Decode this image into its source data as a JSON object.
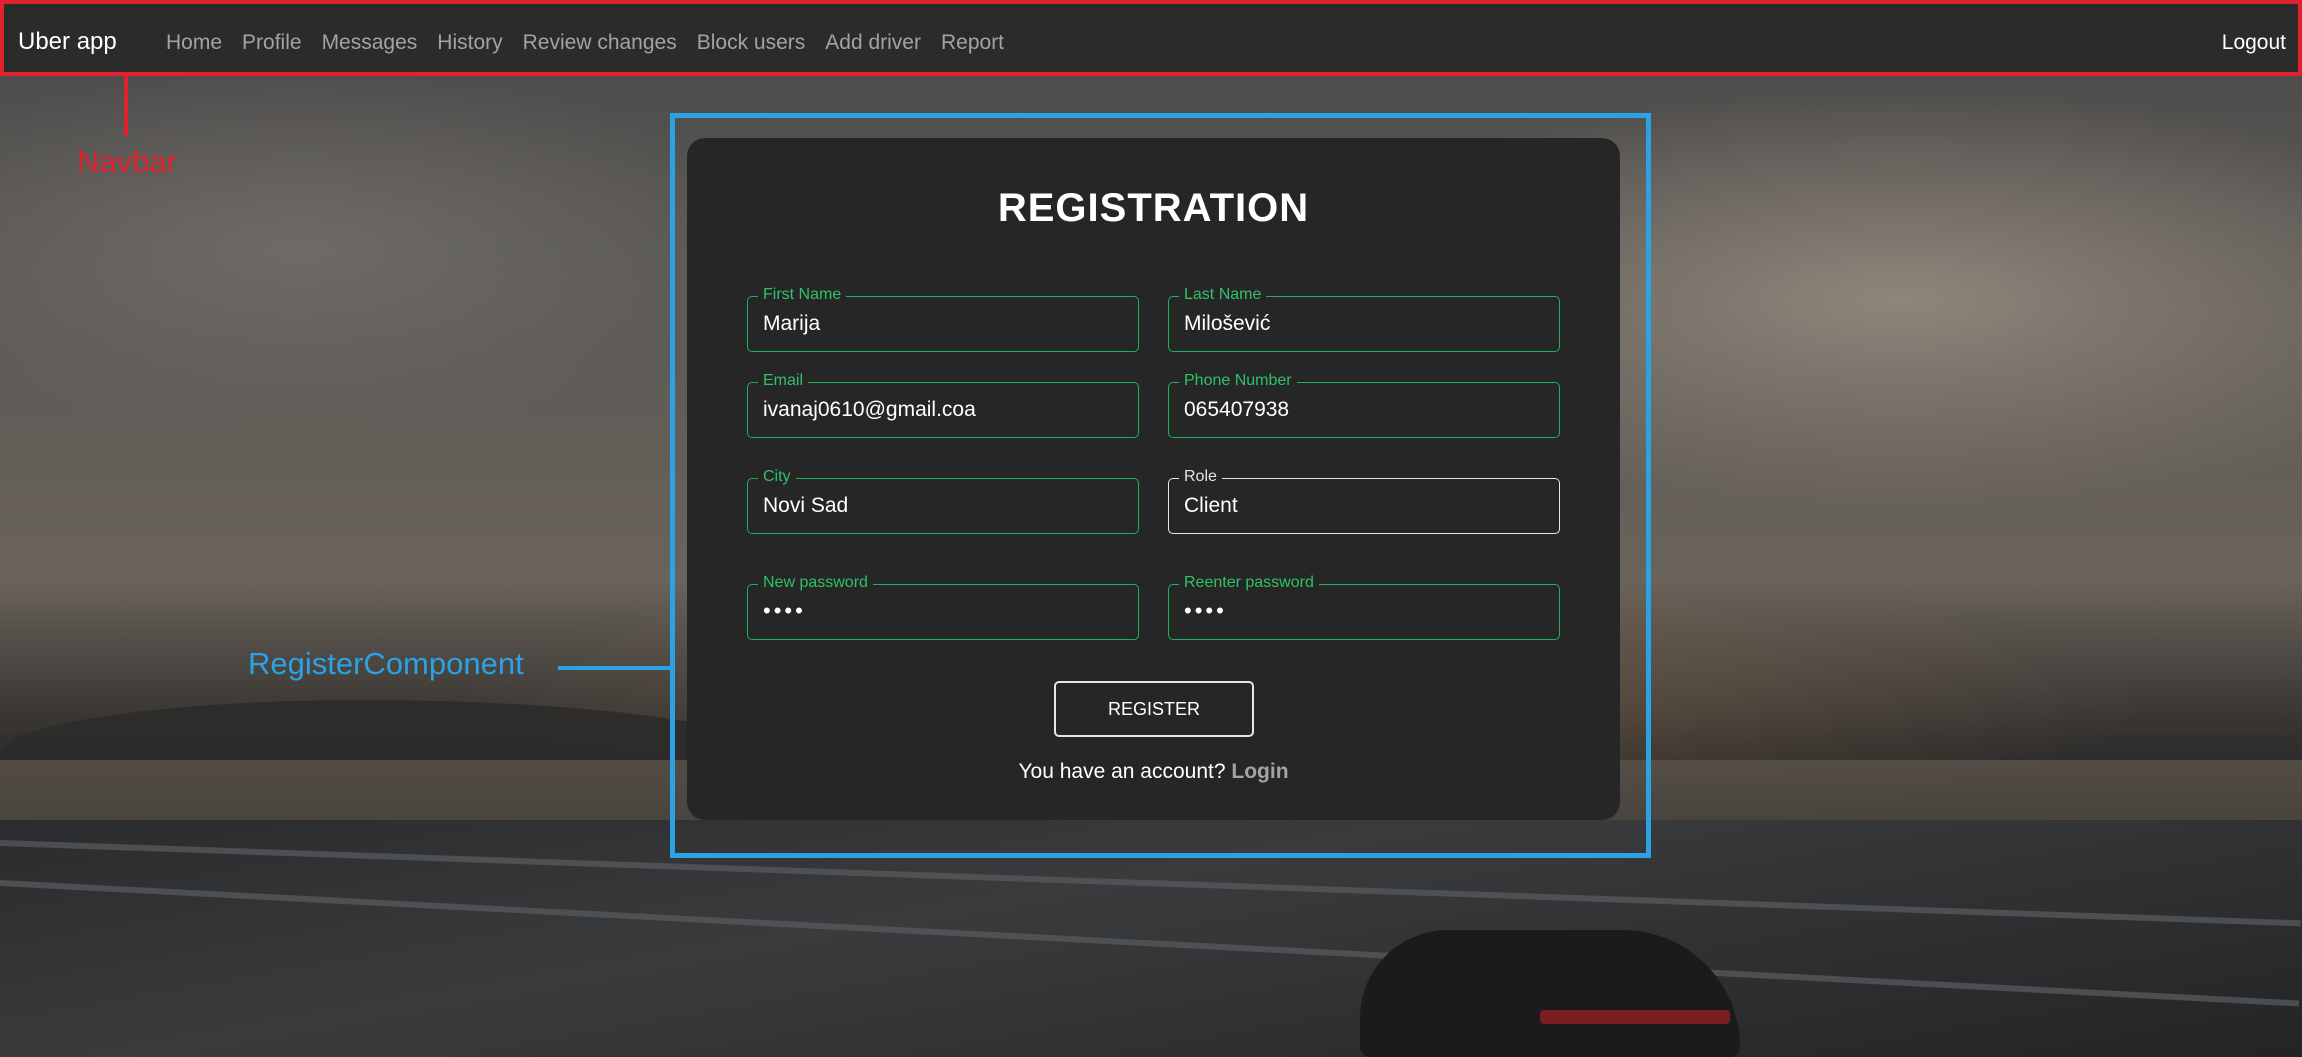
{
  "navbar": {
    "brand": "Uber app",
    "links": [
      "Home",
      "Profile",
      "Messages",
      "History",
      "Review changes",
      "Block users",
      "Add driver",
      "Report"
    ],
    "logout": "Logout"
  },
  "annotations": {
    "navbar_label": "Navbar",
    "register_label": "RegisterComponent",
    "navbar_color": "#e0222e",
    "register_color": "#2aa2e4"
  },
  "form": {
    "title": "REGISTRATION",
    "fields": {
      "first_name": {
        "label": "First Name",
        "value": "Marija"
      },
      "last_name": {
        "label": "Last Name",
        "value": "Milošević"
      },
      "email": {
        "label": "Email",
        "value": "ivanaj0610@gmail.coa"
      },
      "phone": {
        "label": "Phone Number",
        "value": "065407938"
      },
      "city": {
        "label": "City",
        "value": "Novi Sad"
      },
      "role": {
        "label": "Role",
        "value": "Client"
      },
      "new_password": {
        "label": "New password",
        "value": "••••"
      },
      "reenter_password": {
        "label": "Reenter password",
        "value": "••••"
      }
    },
    "register_button": "REGISTER",
    "account_text": "You have an account?",
    "login_link": "Login",
    "accent_color": "#1fb25a"
  }
}
